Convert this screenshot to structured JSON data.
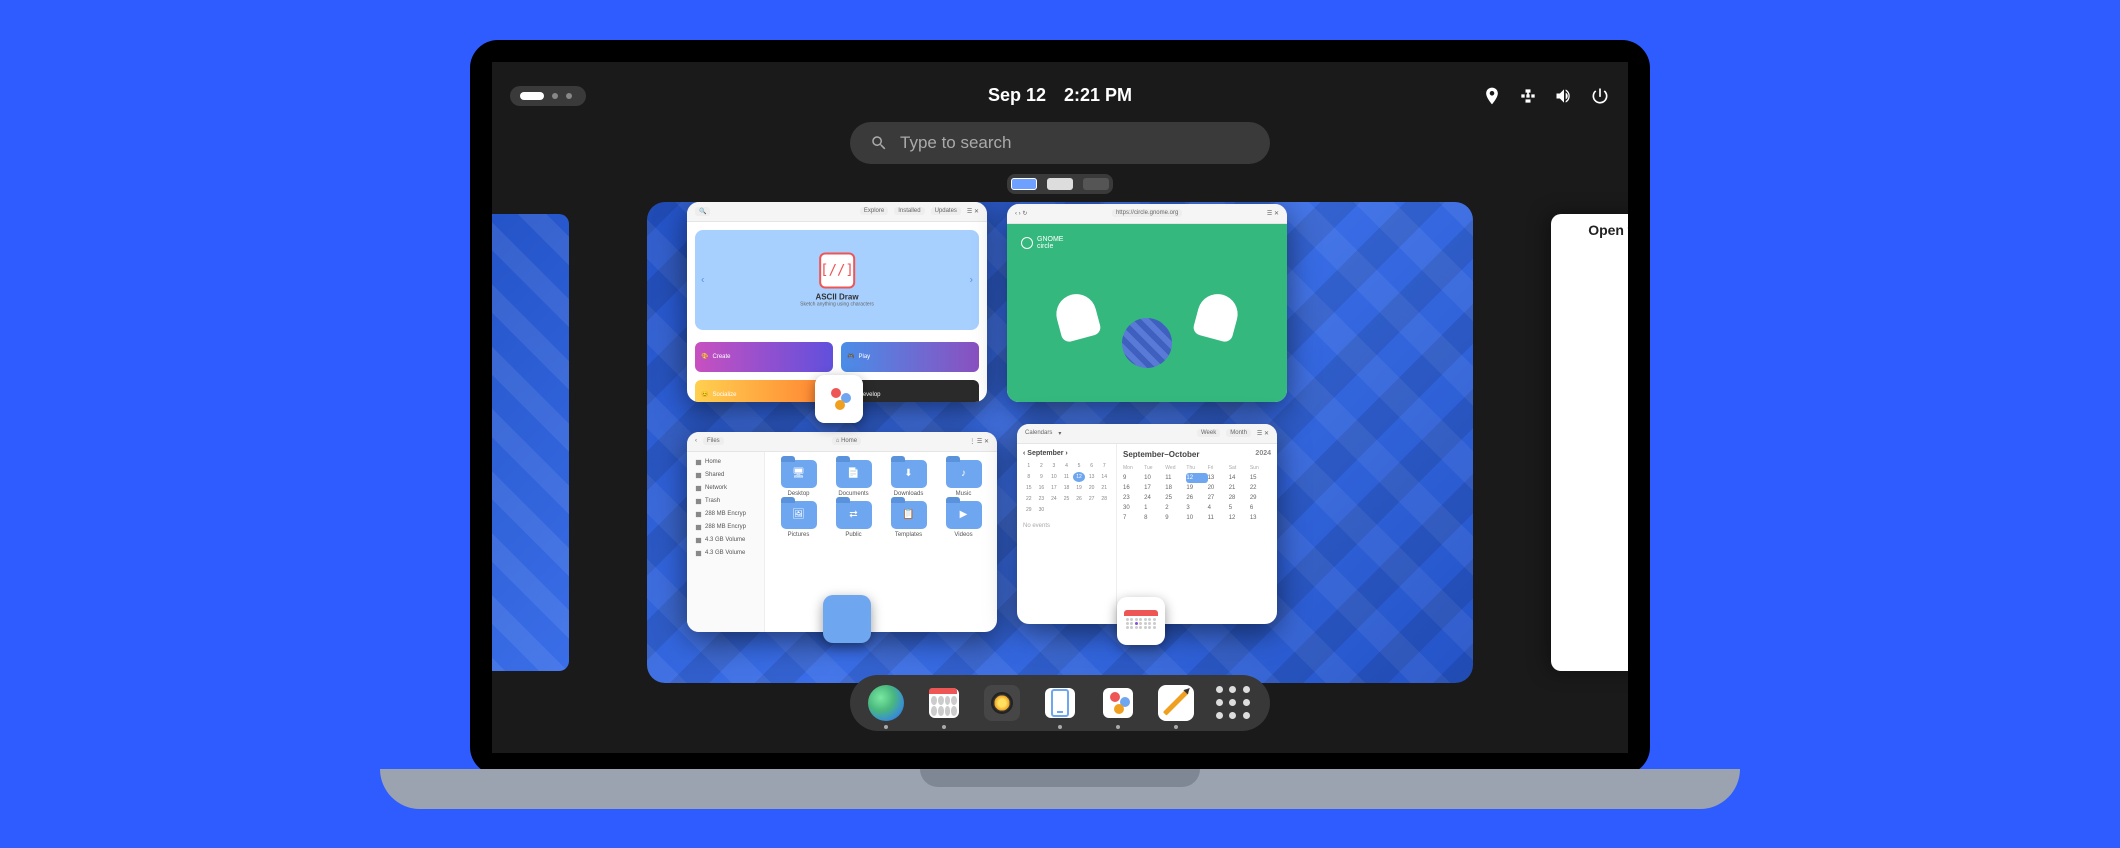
{
  "topbar": {
    "date": "Sep 12",
    "time": "2:21 PM"
  },
  "search": {
    "placeholder": "Type to search"
  },
  "right_panel": {
    "open_label": "Open"
  },
  "windows": {
    "software": {
      "header": {
        "explore": "Explore",
        "installed": "Installed",
        "updates": "Updates"
      },
      "featured_title": "ASCII Draw",
      "featured_subtitle": "Sketch anything using characters",
      "featured_icon_text": "[//]",
      "categories": {
        "create": "Create",
        "play": "Play",
        "socialize": "Socialize",
        "develop": "Develop"
      }
    },
    "web": {
      "url_display": "https://circle.gnome.org",
      "brand_top": "GNOME",
      "brand_bottom": "circle"
    },
    "files": {
      "header_left": "Files",
      "breadcrumb": "Home",
      "sidebar": [
        "Home",
        "Shared",
        "Network",
        "Trash",
        "288 MB Encryp",
        "288 MB Encryp",
        "4.3 GB Volume",
        "4.3 GB Volume"
      ],
      "folders": [
        "Desktop",
        "Documents",
        "Downloads",
        "Music",
        "Pictures",
        "Public",
        "Templates",
        "Videos"
      ]
    },
    "calendar": {
      "header": {
        "left": "Calendars",
        "week": "Week",
        "month": "Month"
      },
      "left_title": "September",
      "right_title": "September–October",
      "year": "2024",
      "no_events": "No events",
      "day_headers": [
        "Mon",
        "Tue",
        "Wed",
        "Thu",
        "Fri",
        "Sat",
        "Sun"
      ]
    }
  },
  "dock": {
    "items": [
      {
        "name": "web",
        "running": true
      },
      {
        "name": "calendar",
        "running": true
      },
      {
        "name": "camera",
        "running": false
      },
      {
        "name": "phone",
        "running": true
      },
      {
        "name": "software",
        "running": true
      },
      {
        "name": "text-editor",
        "running": true
      },
      {
        "name": "show-apps",
        "running": false
      }
    ]
  }
}
